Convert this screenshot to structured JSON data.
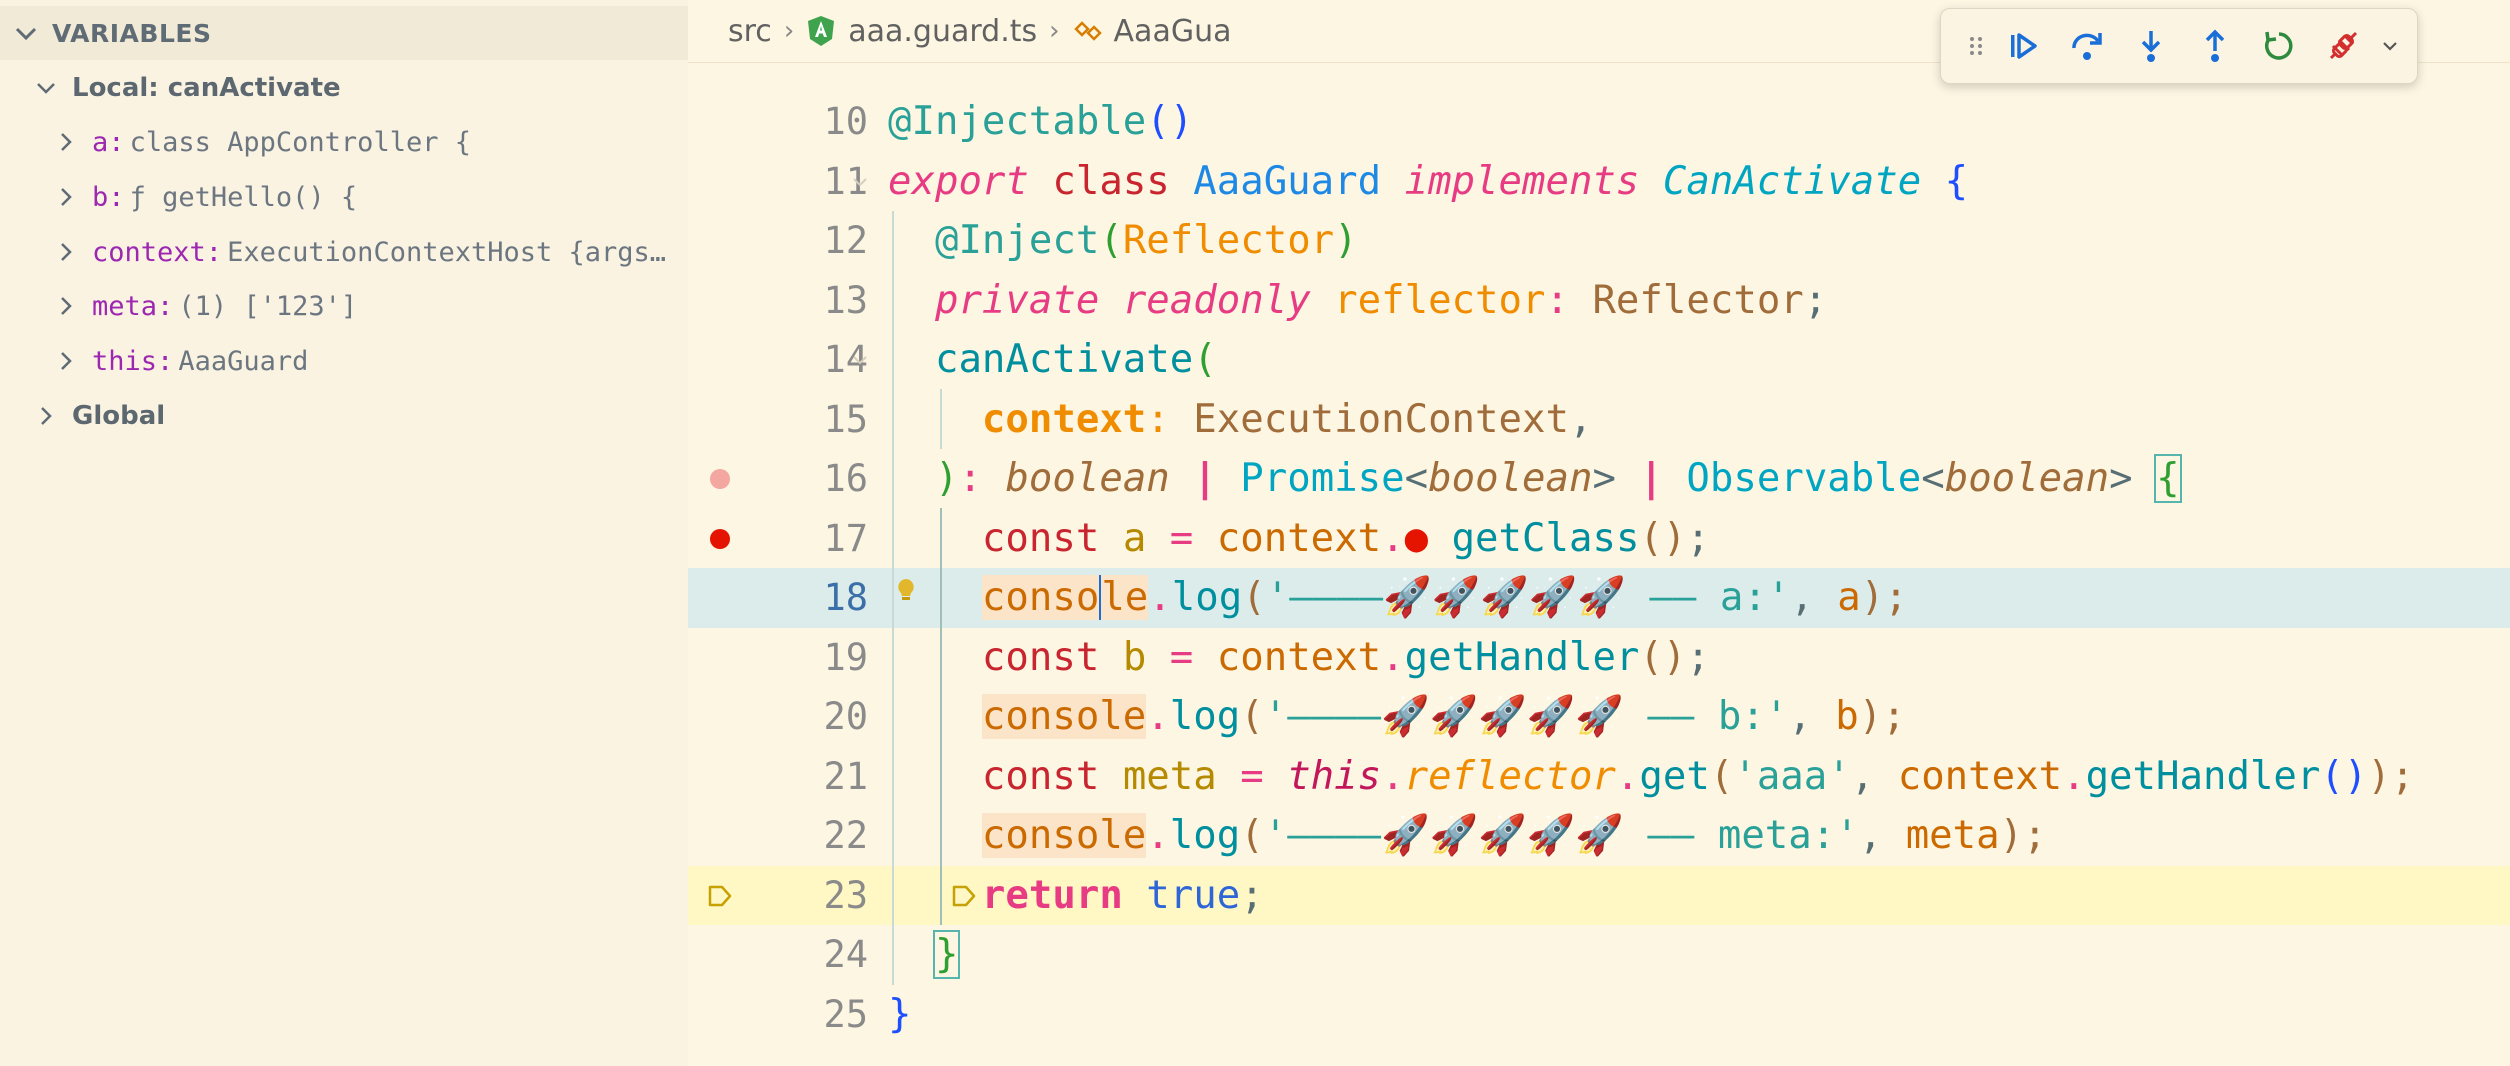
{
  "variables_panel": {
    "title": "VARIABLES",
    "local_scope": "Local: canActivate",
    "items": [
      {
        "name": "a:",
        "value": "class AppController {"
      },
      {
        "name": "b:",
        "value": "ƒ getHello() {"
      },
      {
        "name": "context:",
        "value": "ExecutionContextHost {args…"
      },
      {
        "name": "meta:",
        "value": "(1) ['123']"
      },
      {
        "name": "this:",
        "value": "AaaGuard"
      }
    ],
    "global_scope": "Global"
  },
  "breadcrumb": {
    "folder": "src",
    "file": "aaa.guard.ts",
    "symbol": "AaaGua"
  },
  "debug_toolbar": {
    "buttons": [
      "continue",
      "step-over",
      "step-into",
      "step-out",
      "restart",
      "disconnect"
    ]
  },
  "editor": {
    "current_line": "18",
    "line_numbers": [
      "10",
      "11",
      "12",
      "13",
      "14",
      "15",
      "16",
      "17",
      "18",
      "19",
      "20",
      "21",
      "22",
      "23",
      "24",
      "25"
    ],
    "tokens": {
      "l10": {
        "decorator": "@Injectable",
        "parens": "()"
      },
      "l11": {
        "export": "export",
        "class": "class",
        "name": "AaaGuard",
        "implements": "implements",
        "iface": "CanActivate",
        "brace": "{"
      },
      "l12": {
        "decorator": "@Inject",
        "open": "(",
        "arg": "Reflector",
        "close": ")"
      },
      "l13": {
        "private": "private",
        "readonly": "readonly",
        "prop": "reflector",
        "colon": ":",
        "type": "Reflector",
        "semi": ";"
      },
      "l14": {
        "method": "canActivate",
        "open": "("
      },
      "l15": {
        "param": "context",
        "colon": ":",
        "type": "ExecutionContext",
        "comma": ","
      },
      "l16": {
        "close": ")",
        "colon": ":",
        "t1": "boolean",
        "bar1": "|",
        "t2": "Promise",
        "lt": "<",
        "t2arg": "boolean",
        "gt": ">",
        "bar2": "|",
        "t3": "Observable",
        "t3arg": "boolean",
        "brace": "{"
      },
      "l17": {
        "const": "const",
        "var": "a",
        "eq": "=",
        "obj": "context",
        "dot": ".",
        "call": "getClass",
        "parens": "()",
        "semi": ";"
      },
      "l18": {
        "console_a": "conso",
        "console_b": "le",
        "dot": ".",
        "log": "log",
        "open": "(",
        "str": "'————🚀🚀🚀🚀🚀 —— a:'",
        "comma": ",",
        "arg": "a",
        "close": ");"
      },
      "l19": {
        "const": "const",
        "var": "b",
        "eq": "=",
        "obj": "context",
        "dot": ".",
        "call": "getHandler",
        "parens": "()",
        "semi": ";"
      },
      "l20": {
        "console": "console",
        "dot": ".",
        "log": "log",
        "open": "(",
        "str": "'————🚀🚀🚀🚀🚀 —— b:'",
        "comma": ",",
        "arg": "b",
        "close": ");"
      },
      "l21": {
        "const": "const",
        "var": "meta",
        "eq": "=",
        "this": "this",
        "dot": ".",
        "prop": "reflector",
        "dot2": ".",
        "get": "get",
        "open": "(",
        "str": "'aaa'",
        "comma": ",",
        "obj": "context",
        "dot3": ".",
        "call": "getHandler",
        "parens": "()",
        "close": ");"
      },
      "l22": {
        "console": "console",
        "dot": ".",
        "log": "log",
        "open": "(",
        "str": "'————🚀🚀🚀🚀🚀 —— meta:'",
        "comma": ",",
        "arg": "meta",
        "close": ");"
      },
      "l23": {
        "return": "return",
        "value": "true",
        "semi": ";"
      },
      "l24": {
        "brace": "}"
      },
      "l25": {
        "brace": "}"
      }
    }
  },
  "colors": {
    "background": "#fdf6e3",
    "current_line_highlight": "#dbeceb",
    "paused_line_highlight": "#fff8c5",
    "breakpoint": "#e51400"
  }
}
